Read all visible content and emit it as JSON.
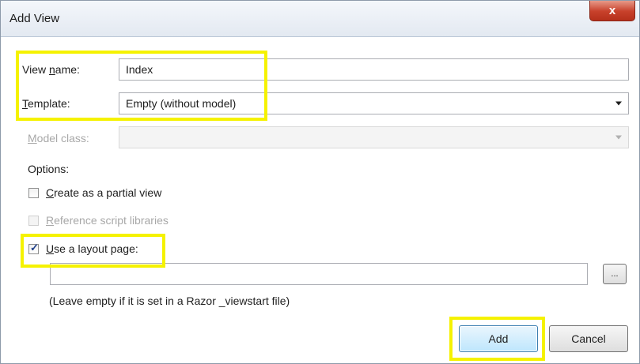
{
  "window": {
    "title": "Add View",
    "close_icon": "close-icon",
    "close_glyph": "x"
  },
  "form": {
    "view_name": {
      "label_u": "View ",
      "label_underlined": "n",
      "label_rest": "ame:",
      "value": "Index"
    },
    "template": {
      "label_underlined": "T",
      "label_rest": "emplate:",
      "value": "Empty (without model)"
    },
    "model_class": {
      "label_underlined": "M",
      "label_rest": "odel class:",
      "value": ""
    },
    "options_label": "Options:",
    "partial_view": {
      "label_underlined": "C",
      "label_rest": "reate as a partial view",
      "checked": false,
      "enabled": true
    },
    "reference_scripts": {
      "label_underlined": "R",
      "label_rest": "eference script libraries",
      "checked": false,
      "enabled": false
    },
    "layout_page": {
      "label_underlined": "U",
      "label_rest": "se a layout page:",
      "checked": true,
      "enabled": true,
      "value": ""
    },
    "browse_label": "...",
    "layout_hint": "(Leave empty if it is set in a Razor _viewstart file)"
  },
  "buttons": {
    "add": "Add",
    "cancel": "Cancel"
  },
  "colors": {
    "highlight": "#f5f200",
    "close_red": "#c8412b"
  }
}
